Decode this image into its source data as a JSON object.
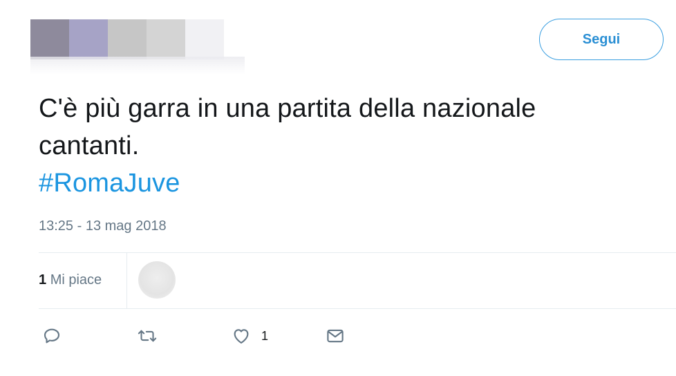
{
  "header": {
    "follow_label": "Segui"
  },
  "tweet": {
    "text_line1": "C'è più garra in una partita della nazionale",
    "text_line2": "cantanti.",
    "hashtag": "#RomaJuve",
    "timestamp": "13:25 - 13 mag 2018"
  },
  "stats": {
    "likes_number": "1",
    "likes_label": "Mi piace"
  },
  "actions": {
    "reply_icon": "reply-icon",
    "retweet_icon": "retweet-icon",
    "like_icon": "heart-icon",
    "like_count": "1",
    "dm_icon": "envelope-icon"
  },
  "colors": {
    "accent": "#1b95e0",
    "muted": "#657786",
    "divider": "#e6ecf0"
  }
}
